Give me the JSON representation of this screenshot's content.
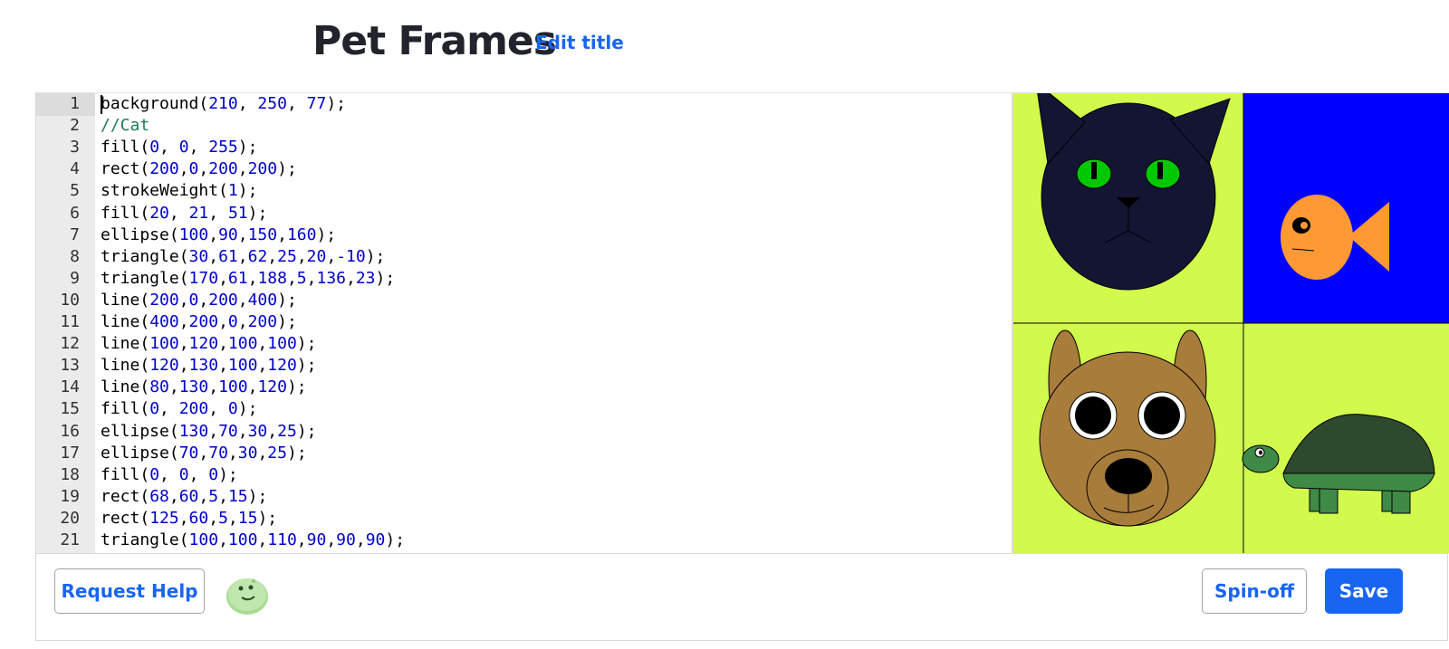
{
  "header": {
    "title": "Pet Frames",
    "edit_title_label": "Edit title"
  },
  "editor": {
    "lines": [
      [
        [
          "",
          "background("
        ],
        [
          "num",
          "210"
        ],
        [
          "",
          ", "
        ],
        [
          "num",
          "250"
        ],
        [
          "",
          ", "
        ],
        [
          "num",
          "77"
        ],
        [
          "",
          ");"
        ]
      ],
      [
        [
          "cmt",
          "//Cat"
        ]
      ],
      [
        [
          "",
          "fill("
        ],
        [
          "num",
          "0"
        ],
        [
          "",
          ", "
        ],
        [
          "num",
          "0"
        ],
        [
          "",
          ", "
        ],
        [
          "num",
          "255"
        ],
        [
          "",
          ");"
        ]
      ],
      [
        [
          "",
          "rect("
        ],
        [
          "num",
          "200"
        ],
        [
          "",
          ","
        ],
        [
          "num",
          "0"
        ],
        [
          "",
          ","
        ],
        [
          "num",
          "200"
        ],
        [
          "",
          ","
        ],
        [
          "num",
          "200"
        ],
        [
          "",
          ");"
        ]
      ],
      [
        [
          "",
          "strokeWeight("
        ],
        [
          "num",
          "1"
        ],
        [
          "",
          ");"
        ]
      ],
      [
        [
          "",
          "fill("
        ],
        [
          "num",
          "20"
        ],
        [
          "",
          ", "
        ],
        [
          "num",
          "21"
        ],
        [
          "",
          ", "
        ],
        [
          "num",
          "51"
        ],
        [
          "",
          ");"
        ]
      ],
      [
        [
          "",
          "ellipse("
        ],
        [
          "num",
          "100"
        ],
        [
          "",
          ","
        ],
        [
          "num",
          "90"
        ],
        [
          "",
          ","
        ],
        [
          "num",
          "150"
        ],
        [
          "",
          ","
        ],
        [
          "num",
          "160"
        ],
        [
          "",
          ");"
        ]
      ],
      [
        [
          "",
          "triangle("
        ],
        [
          "num",
          "30"
        ],
        [
          "",
          ","
        ],
        [
          "num",
          "61"
        ],
        [
          "",
          ","
        ],
        [
          "num",
          "62"
        ],
        [
          "",
          ","
        ],
        [
          "num",
          "25"
        ],
        [
          "",
          ","
        ],
        [
          "num",
          "20"
        ],
        [
          "",
          ","
        ],
        [
          "num",
          "-10"
        ],
        [
          "",
          ");"
        ]
      ],
      [
        [
          "",
          "triangle("
        ],
        [
          "num",
          "170"
        ],
        [
          "",
          ","
        ],
        [
          "num",
          "61"
        ],
        [
          "",
          ","
        ],
        [
          "num",
          "188"
        ],
        [
          "",
          ","
        ],
        [
          "num",
          "5"
        ],
        [
          "",
          ","
        ],
        [
          "num",
          "136"
        ],
        [
          "",
          ","
        ],
        [
          "num",
          "23"
        ],
        [
          "",
          ");"
        ]
      ],
      [
        [
          "",
          "line("
        ],
        [
          "num",
          "200"
        ],
        [
          "",
          ","
        ],
        [
          "num",
          "0"
        ],
        [
          "",
          ","
        ],
        [
          "num",
          "200"
        ],
        [
          "",
          ","
        ],
        [
          "num",
          "400"
        ],
        [
          "",
          ");"
        ]
      ],
      [
        [
          "",
          "line("
        ],
        [
          "num",
          "400"
        ],
        [
          "",
          ","
        ],
        [
          "num",
          "200"
        ],
        [
          "",
          ","
        ],
        [
          "num",
          "0"
        ],
        [
          "",
          ","
        ],
        [
          "num",
          "200"
        ],
        [
          "",
          ");"
        ]
      ],
      [
        [
          "",
          "line("
        ],
        [
          "num",
          "100"
        ],
        [
          "",
          ","
        ],
        [
          "num",
          "120"
        ],
        [
          "",
          ","
        ],
        [
          "num",
          "100"
        ],
        [
          "",
          ","
        ],
        [
          "num",
          "100"
        ],
        [
          "",
          ");"
        ]
      ],
      [
        [
          "",
          "line("
        ],
        [
          "num",
          "120"
        ],
        [
          "",
          ","
        ],
        [
          "num",
          "130"
        ],
        [
          "",
          ","
        ],
        [
          "num",
          "100"
        ],
        [
          "",
          ","
        ],
        [
          "num",
          "120"
        ],
        [
          "",
          ");"
        ]
      ],
      [
        [
          "",
          "line("
        ],
        [
          "num",
          "80"
        ],
        [
          "",
          ","
        ],
        [
          "num",
          "130"
        ],
        [
          "",
          ","
        ],
        [
          "num",
          "100"
        ],
        [
          "",
          ","
        ],
        [
          "num",
          "120"
        ],
        [
          "",
          ");"
        ]
      ],
      [
        [
          "",
          "fill("
        ],
        [
          "num",
          "0"
        ],
        [
          "",
          ", "
        ],
        [
          "num",
          "200"
        ],
        [
          "",
          ", "
        ],
        [
          "num",
          "0"
        ],
        [
          "",
          ");"
        ]
      ],
      [
        [
          "",
          "ellipse("
        ],
        [
          "num",
          "130"
        ],
        [
          "",
          ","
        ],
        [
          "num",
          "70"
        ],
        [
          "",
          ","
        ],
        [
          "num",
          "30"
        ],
        [
          "",
          ","
        ],
        [
          "num",
          "25"
        ],
        [
          "",
          ");"
        ]
      ],
      [
        [
          "",
          "ellipse("
        ],
        [
          "num",
          "70"
        ],
        [
          "",
          ","
        ],
        [
          "num",
          "70"
        ],
        [
          "",
          ","
        ],
        [
          "num",
          "30"
        ],
        [
          "",
          ","
        ],
        [
          "num",
          "25"
        ],
        [
          "",
          ");"
        ]
      ],
      [
        [
          "",
          "fill("
        ],
        [
          "num",
          "0"
        ],
        [
          "",
          ", "
        ],
        [
          "num",
          "0"
        ],
        [
          "",
          ", "
        ],
        [
          "num",
          "0"
        ],
        [
          "",
          ");"
        ]
      ],
      [
        [
          "",
          "rect("
        ],
        [
          "num",
          "68"
        ],
        [
          "",
          ","
        ],
        [
          "num",
          "60"
        ],
        [
          "",
          ","
        ],
        [
          "num",
          "5"
        ],
        [
          "",
          ","
        ],
        [
          "num",
          "15"
        ],
        [
          "",
          ");"
        ]
      ],
      [
        [
          "",
          "rect("
        ],
        [
          "num",
          "125"
        ],
        [
          "",
          ","
        ],
        [
          "num",
          "60"
        ],
        [
          "",
          ","
        ],
        [
          "num",
          "5"
        ],
        [
          "",
          ","
        ],
        [
          "num",
          "15"
        ],
        [
          "",
          ");"
        ]
      ],
      [
        [
          "",
          "triangle("
        ],
        [
          "num",
          "100"
        ],
        [
          "",
          ","
        ],
        [
          "num",
          "100"
        ],
        [
          "",
          ","
        ],
        [
          "num",
          "110"
        ],
        [
          "",
          ","
        ],
        [
          "num",
          "90"
        ],
        [
          "",
          ","
        ],
        [
          "num",
          "90"
        ],
        [
          "",
          ","
        ],
        [
          "num",
          "90"
        ],
        [
          "",
          ");"
        ]
      ]
    ],
    "active_line": 1
  },
  "canvas": {
    "background_color": "#d2fa4d",
    "fish_panel_color": "#0000ff",
    "cat_color": "#141533",
    "cat_eye_color": "#00c800",
    "fish_color": "#ff9933",
    "dog_color": "#a87c3b",
    "turtle_shell_color": "#2e4a2e",
    "turtle_body_color": "#3f8a46"
  },
  "toolbar": {
    "request_help_label": "Request Help",
    "avatar_icon": "green-creature-avatar-icon",
    "spinoff_label": "Spin-off",
    "save_label": "Save"
  },
  "theme": {
    "accent": "#1865f2",
    "gutter_bg": "#ebebeb",
    "number_color": "#0000cd",
    "comment_color": "#1c7c52"
  }
}
